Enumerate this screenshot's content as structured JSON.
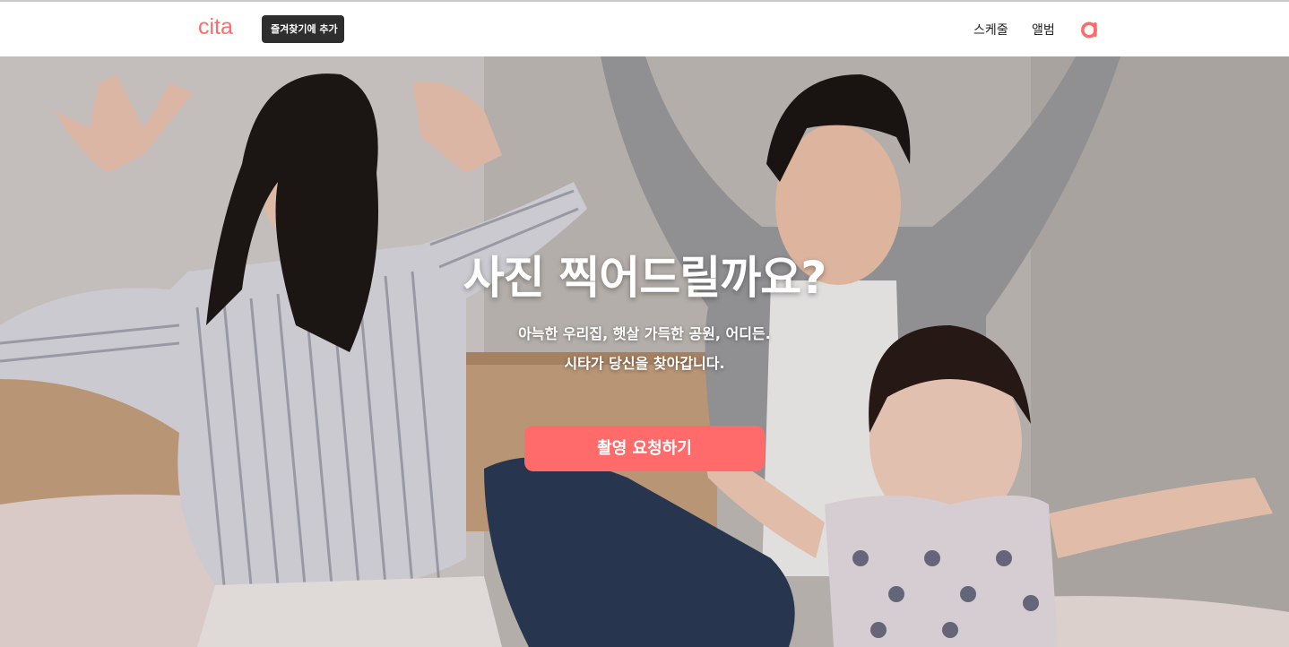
{
  "header": {
    "logo_text": "cita",
    "bookmark_label": "즐겨찾기에 추가",
    "nav": [
      {
        "label": "스케줄"
      },
      {
        "label": "앨범"
      }
    ],
    "profile_icon": "profile-icon"
  },
  "hero": {
    "title": "사진 찍어드릴까요?",
    "subtitle_line1": "아늑한 우리집, 햇살 가득한 공원, 어디든.",
    "subtitle_line2": "시타가 당신을 찾아갑니다.",
    "cta_label": "촬영 요청하기",
    "image": "family-photo"
  },
  "colors": {
    "brand": "#ff6b6b",
    "bookmark_bg": "#2e2e2e",
    "header_bg": "#ffffff"
  }
}
